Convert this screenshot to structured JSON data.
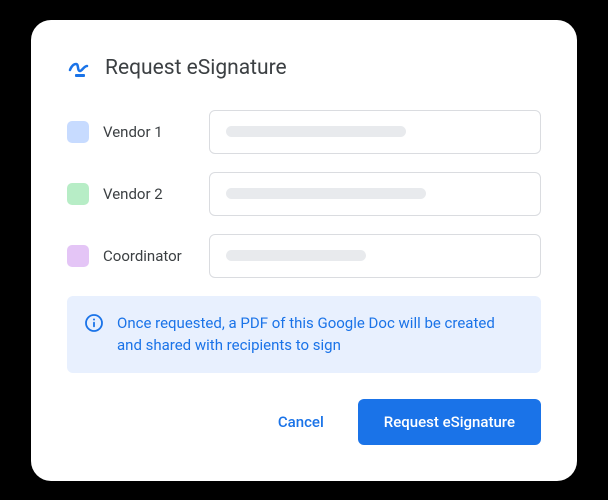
{
  "header": {
    "title": "Request eSignature"
  },
  "signers": [
    {
      "label": "Vendor 1",
      "color": "blue"
    },
    {
      "label": "Vendor 2",
      "color": "green"
    },
    {
      "label": "Coordinator",
      "color": "purple"
    }
  ],
  "info": {
    "text": "Once requested, a PDF of this Google Doc will be created and shared with recipients to sign"
  },
  "actions": {
    "cancel": "Cancel",
    "submit": "Request eSignature"
  }
}
